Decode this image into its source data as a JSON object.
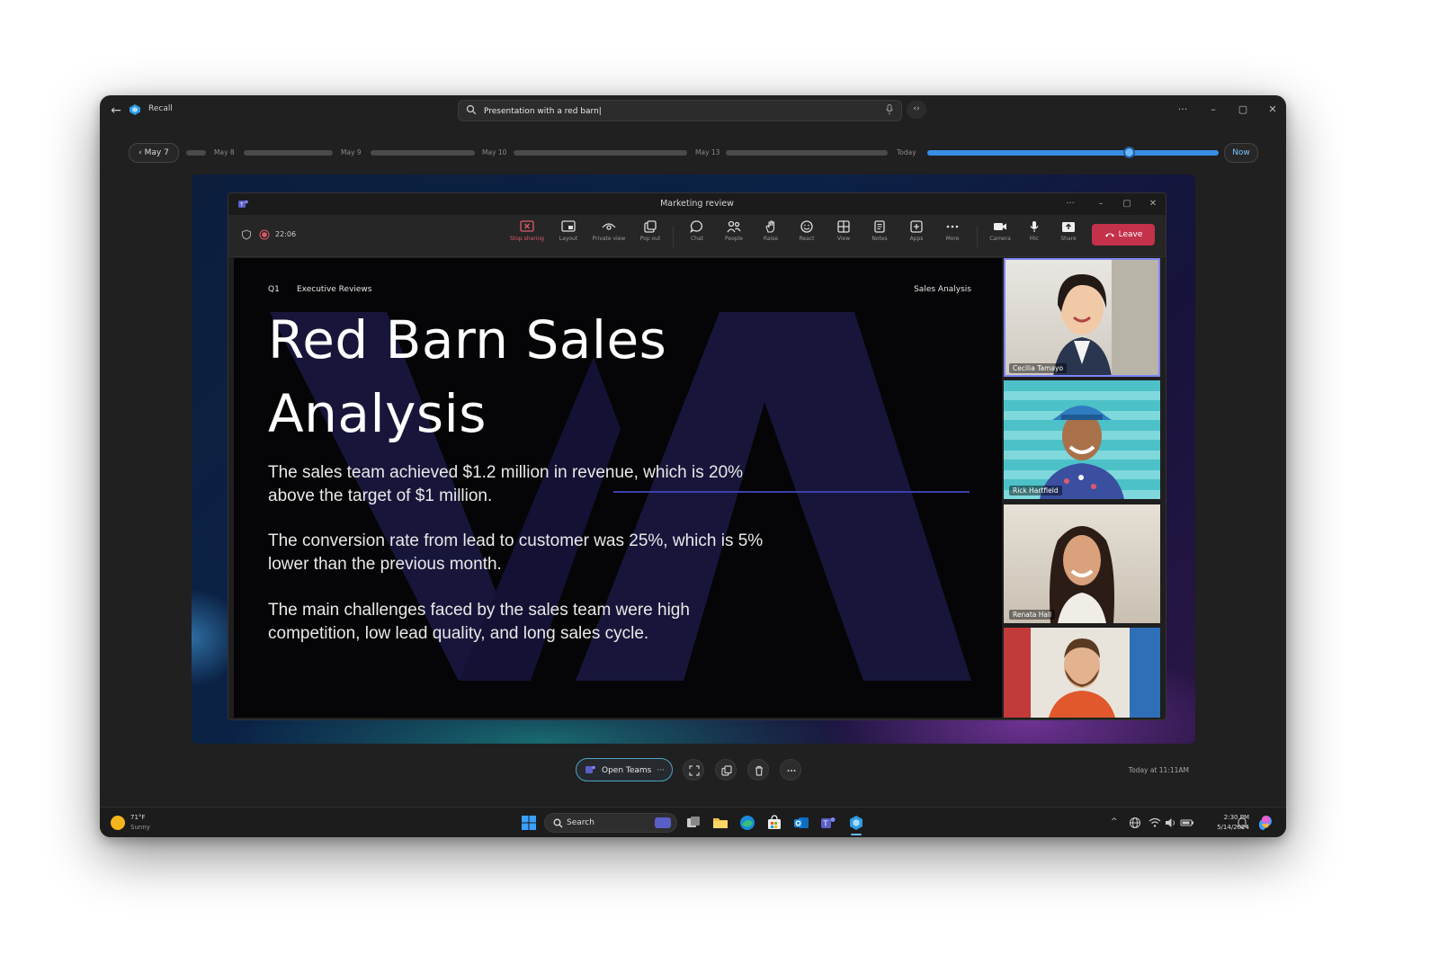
{
  "recall": {
    "title": "Recall",
    "search_value": "Presentation with a red barn|",
    "timeline": {
      "back_label": "May 7",
      "labels": [
        "May 8",
        "May 9",
        "May 10",
        "May 13",
        "Today"
      ],
      "now_label": "Now"
    }
  },
  "teams": {
    "window_title": "Marketing review",
    "timer": "22:06",
    "toolbar": [
      {
        "label": "Stop sharing",
        "icon": "stop-sharing-icon"
      },
      {
        "label": "Layout",
        "icon": "layout-icon"
      },
      {
        "label": "Private view",
        "icon": "private-view-icon"
      },
      {
        "label": "Pop out",
        "icon": "pop-out-icon"
      },
      {
        "label": "Chat",
        "icon": "chat-icon"
      },
      {
        "label": "People",
        "icon": "people-icon"
      },
      {
        "label": "Raise",
        "icon": "raise-hand-icon"
      },
      {
        "label": "React",
        "icon": "react-icon"
      },
      {
        "label": "View",
        "icon": "view-icon"
      },
      {
        "label": "Notes",
        "icon": "notes-icon"
      },
      {
        "label": "Apps",
        "icon": "apps-icon"
      },
      {
        "label": "More",
        "icon": "more-icon"
      },
      {
        "label": "Camera",
        "icon": "camera-icon"
      },
      {
        "label": "Mic",
        "icon": "mic-icon"
      },
      {
        "label": "Share",
        "icon": "share-icon"
      }
    ],
    "leave_label": "Leave",
    "participants": [
      {
        "name": "Cecilia Tamayo"
      },
      {
        "name": "Rick Hartfield"
      },
      {
        "name": "Renata Hall"
      },
      {
        "name": ""
      }
    ]
  },
  "slide": {
    "quarter": "Q1",
    "section": "Executive Reviews",
    "topic": "Sales Analysis",
    "title_line1": "Red Barn Sales",
    "title_line2": "Analysis",
    "para1_line1": "The sales team achieved $1.2 million in revenue, which is 20%",
    "para1_line2": "above the target of $1 million.",
    "para2_line1": "The conversion rate from lead to customer was 25%, which is 5%",
    "para2_line2": "lower than the previous month.",
    "para3_line1": "The main challenges faced by the sales team were high",
    "para3_line2": "competition, low lead quality, and long sales cycle."
  },
  "actions": {
    "open_teams_label": "Open Teams",
    "more_glyph": "···",
    "timestamp": "Today at 11:11AM"
  },
  "taskbar": {
    "temperature": "71°F",
    "condition": "Sunny",
    "search_label": "Search",
    "time": "2:30 PM",
    "date": "5/14/2024"
  },
  "colors": {
    "accent": "#3a8ee6",
    "leave": "#c4314b",
    "stop_sharing": "#e05a6a",
    "teams_purple": "#7f85f5"
  }
}
